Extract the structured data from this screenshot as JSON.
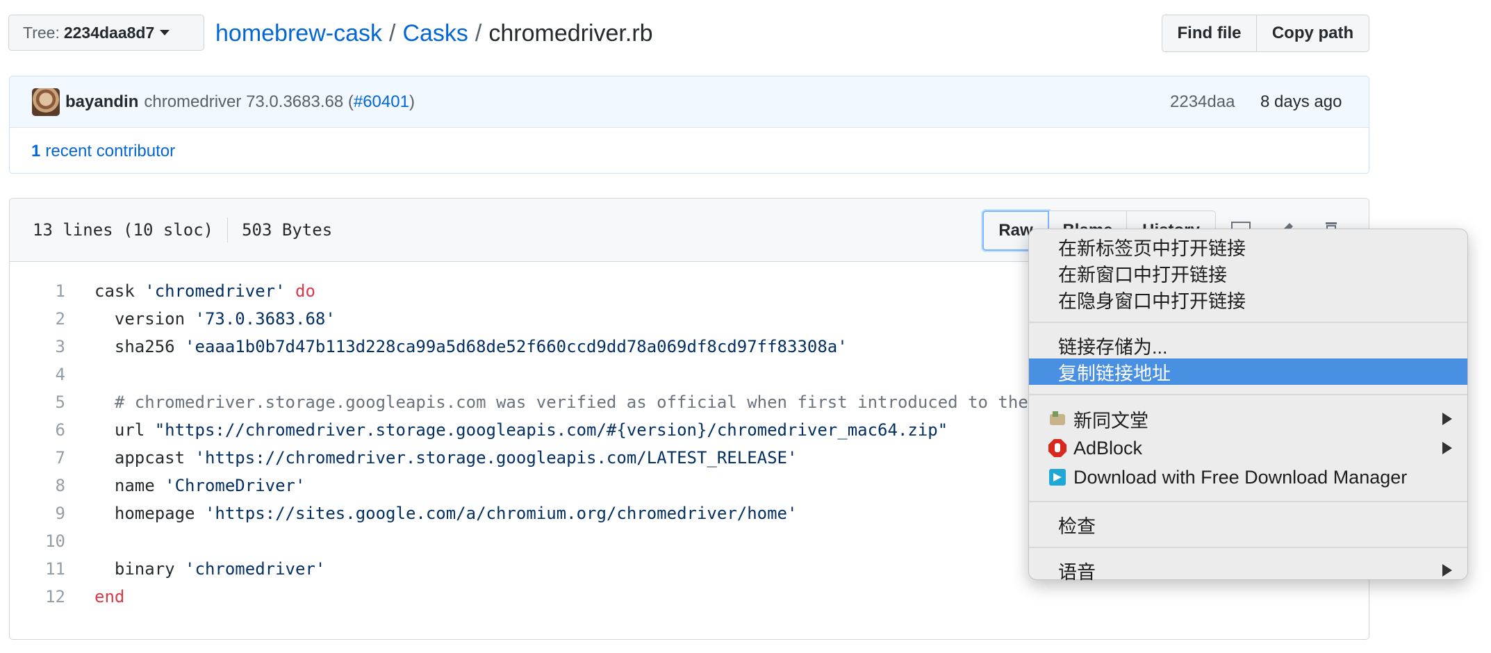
{
  "tree": {
    "label": "Tree:",
    "value": "2234daa8d7"
  },
  "breadcrumb": {
    "repo": "homebrew-cask",
    "folder": "Casks",
    "file": "chromedriver.rb",
    "sep": "/"
  },
  "actions": {
    "find_file": "Find file",
    "copy_path": "Copy path"
  },
  "commit": {
    "author": "bayandin",
    "message": "chromedriver 73.0.3683.68 (",
    "pr": "#60401",
    "message_end": ")",
    "sha": "2234daa",
    "date": "8 days ago",
    "contributors_count": "1",
    "contributors_label": "recent contributor"
  },
  "file": {
    "lines": "13 lines (10 sloc)",
    "size": "503 Bytes",
    "raw": "Raw",
    "blame": "Blame",
    "history": "History",
    "code": [
      {
        "n": "1",
        "parts": [
          [
            "",
            "cask "
          ],
          [
            "str",
            "'chromedriver'"
          ],
          [
            "",
            " "
          ],
          [
            "kw",
            "do"
          ]
        ]
      },
      {
        "n": "2",
        "parts": [
          [
            "",
            "  version "
          ],
          [
            "str",
            "'73.0.3683.68'"
          ]
        ]
      },
      {
        "n": "3",
        "parts": [
          [
            "",
            "  sha256 "
          ],
          [
            "str",
            "'eaaa1b0b7d47b113d228ca99a5d68de52f660ccd9dd78a069df8cd97ff83308a'"
          ]
        ]
      },
      {
        "n": "4",
        "parts": []
      },
      {
        "n": "5",
        "parts": [
          [
            "cmt",
            "  # chromedriver.storage.googleapis.com was verified as official when first introduced to the"
          ]
        ]
      },
      {
        "n": "6",
        "parts": [
          [
            "",
            "  url "
          ],
          [
            "str",
            "\"https://chromedriver.storage.googleapis.com/#{version}/chromedriver_mac64.zip\""
          ]
        ]
      },
      {
        "n": "7",
        "parts": [
          [
            "",
            "  appcast "
          ],
          [
            "str",
            "'https://chromedriver.storage.googleapis.com/LATEST_RELEASE'"
          ]
        ]
      },
      {
        "n": "8",
        "parts": [
          [
            "",
            "  name "
          ],
          [
            "str",
            "'ChromeDriver'"
          ]
        ]
      },
      {
        "n": "9",
        "parts": [
          [
            "",
            "  homepage "
          ],
          [
            "str",
            "'https://sites.google.com/a/chromium.org/chromedriver/home'"
          ]
        ]
      },
      {
        "n": "10",
        "parts": []
      },
      {
        "n": "11",
        "parts": [
          [
            "",
            "  binary "
          ],
          [
            "str",
            "'chromedriver'"
          ]
        ]
      },
      {
        "n": "12",
        "parts": [
          [
            "kw",
            "end"
          ]
        ]
      }
    ]
  },
  "context_menu": {
    "open_new_tab": "在新标签页中打开链接",
    "open_new_window": "在新窗口中打开链接",
    "open_incognito": "在隐身窗口中打开链接",
    "save_link_as": "链接存储为...",
    "copy_link": "复制链接地址",
    "ext_xintongwentang": "新同文堂",
    "ext_adblock": "AdBlock",
    "ext_fdm": "Download with Free Download Manager",
    "inspect": "检查",
    "speech": "语音"
  },
  "colors": {
    "link": "#0366d6",
    "keyword": "#d73a49",
    "string": "#032f62",
    "comment": "#6a737d",
    "menu_highlight": "#4a90e2"
  }
}
